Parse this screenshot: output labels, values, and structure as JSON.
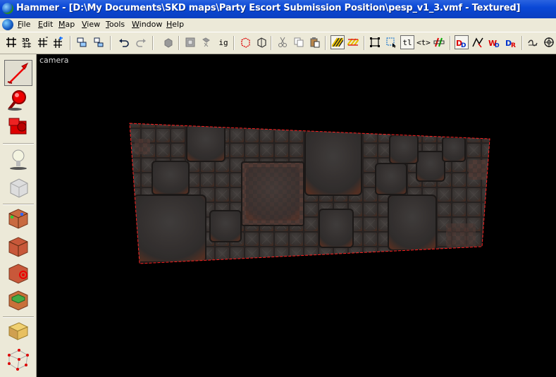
{
  "window": {
    "title": "Hammer - [D:\\My Documents\\SKD maps\\Party Escort Submission Position\\pesp_v1_3.vmf - Textured]"
  },
  "menu": {
    "items": [
      {
        "label": "File",
        "key": "F"
      },
      {
        "label": "Edit",
        "key": "E"
      },
      {
        "label": "Map",
        "key": "M"
      },
      {
        "label": "View",
        "key": "V"
      },
      {
        "label": "Tools",
        "key": "T"
      },
      {
        "label": "Window",
        "key": "W"
      },
      {
        "label": "Help",
        "key": "H"
      }
    ]
  },
  "toolbar": {
    "ig_label": "ig",
    "tl_label": "tl",
    "toggle_label": "<t>"
  },
  "viewport": {
    "label": "camera",
    "background": "#000000",
    "selection_color": "#ff2020"
  },
  "palette": {
    "tools": [
      "selection",
      "magnify",
      "camera",
      "entity",
      "block",
      "texture-application",
      "apply-current-texture",
      "decal",
      "overlay",
      "clipping",
      "vertex-manipulation"
    ]
  }
}
